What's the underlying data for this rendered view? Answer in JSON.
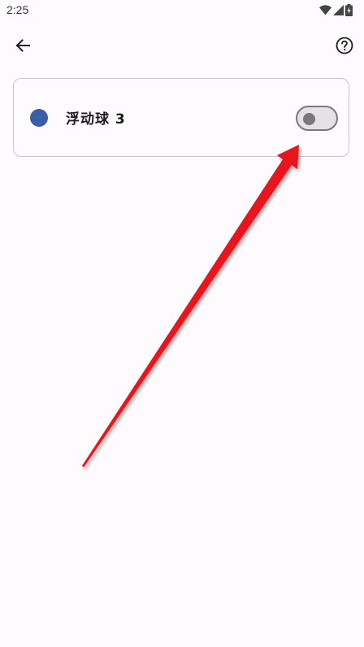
{
  "status_bar": {
    "time": "2:25",
    "icons": [
      "wifi-icon",
      "signal-icon",
      "battery-icon"
    ]
  },
  "app_bar": {
    "back_icon": "arrow-left-icon",
    "help_icon": "help-circle-icon"
  },
  "card": {
    "label": "浮动球 3",
    "dot_color": "#3b5ea8",
    "switch_on": false
  },
  "annotation": {
    "color": "#e8141c"
  }
}
